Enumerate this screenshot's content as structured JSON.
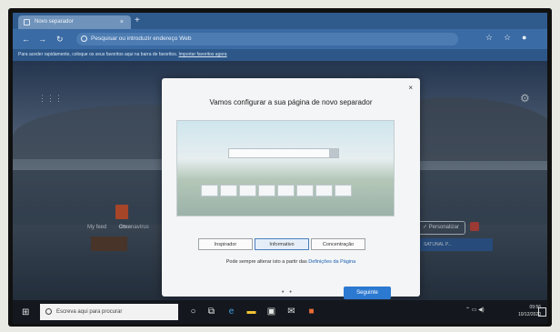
{
  "browser": {
    "tab_title": "Novo separador",
    "tab_close": "×",
    "new_tab": "+",
    "address_placeholder": "Pesquisar ou introduzir endereço Web",
    "fav_bar_text": "Para aceder rapidamente, coloque os seus favoritos aqui na barra de favoritos.",
    "fav_bar_link": "Importar favoritos agora"
  },
  "ntp": {
    "office_label": "Office",
    "feed_links": [
      "My feed",
      "Coronavírus"
    ],
    "personalize": "✓ Personalizar",
    "news_strip": "SATUNAL P..."
  },
  "modal": {
    "title": "Vamos configurar a sua página de novo separador",
    "close": "×",
    "layout_options": [
      "Inspirador",
      "Informativo",
      "Concentração"
    ],
    "selected_option": "Informativo",
    "note_prefix": "Pode sempre alterar isto a partir das ",
    "note_link": "Definições da Página",
    "next_button": "Seguinte",
    "dots": "• •"
  },
  "taskbar": {
    "search_placeholder": "Escreva aqui para procurar",
    "time": "09:56",
    "date": "10/12/2020"
  }
}
